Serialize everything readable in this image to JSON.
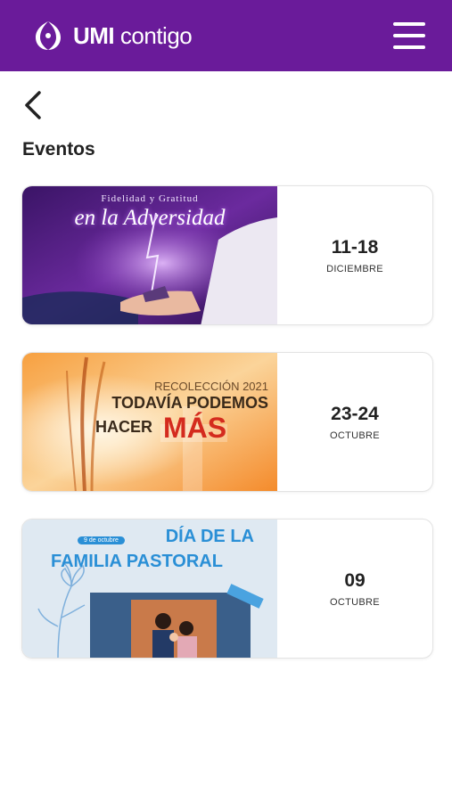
{
  "header": {
    "brand_bold": "UMI",
    "brand_light": " contigo"
  },
  "page": {
    "title": "Eventos"
  },
  "events": [
    {
      "banner_line1": "Fidelidad y Gratitud",
      "banner_line2": "en la Adversidad",
      "date": "11-18",
      "month": "DICIEMBRE"
    },
    {
      "banner_line1": "RECOLECCIÓN 2021",
      "banner_line2": "TODAVÍA PODEMOS",
      "banner_line3": "HACER",
      "banner_line4": "MÁS",
      "date": "23-24",
      "month": "OCTUBRE"
    },
    {
      "banner_pill": "9 de octubre",
      "banner_line1": "DÍA DE LA",
      "banner_line2": "FAMILIA PASTORAL",
      "date": "09",
      "month": "OCTUBRE"
    }
  ],
  "colors": {
    "header": "#6a1b9a",
    "accent_red": "#d42b1e",
    "accent_blue": "#2a8fd6"
  }
}
